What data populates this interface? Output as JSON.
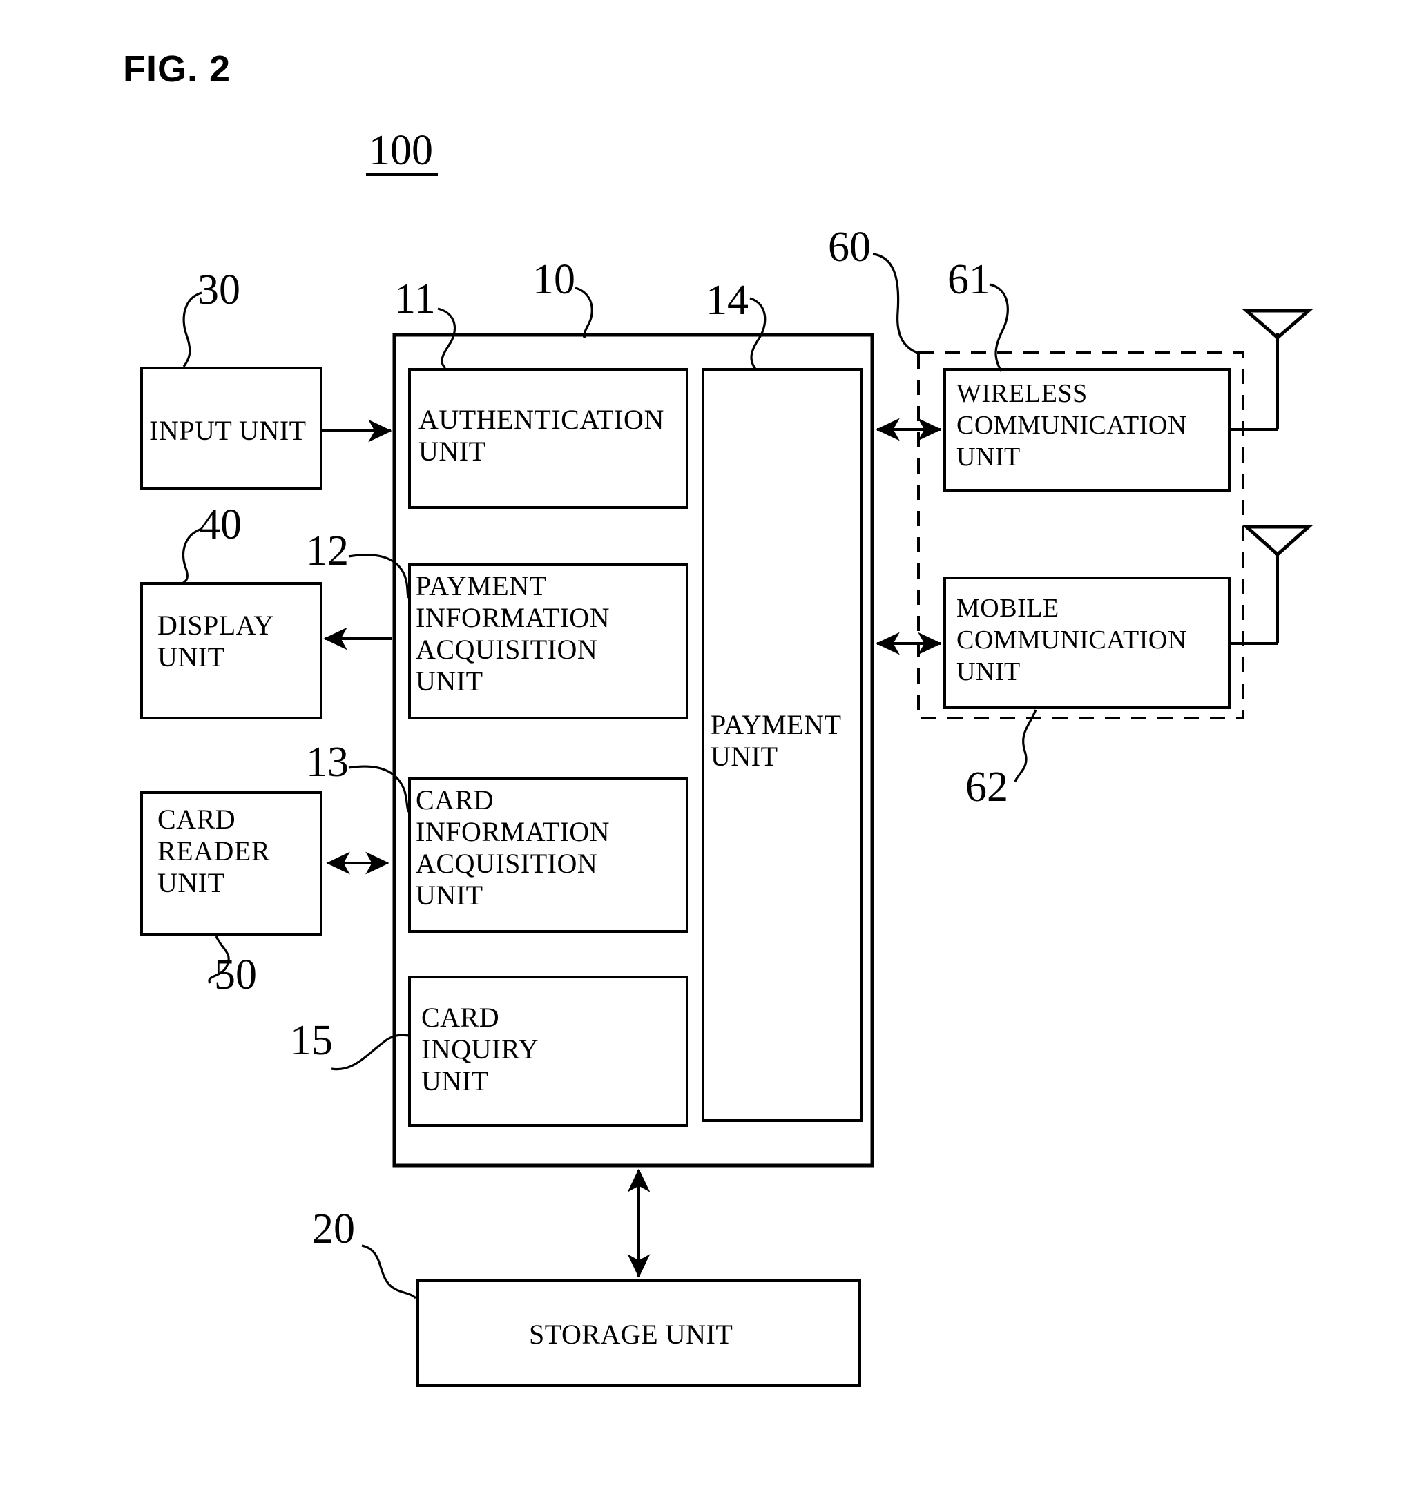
{
  "figure": {
    "title": "FIG. 2",
    "system_ref": "100"
  },
  "blocks": {
    "control_unit": {
      "ref": "10",
      "label": ""
    },
    "authentication_unit": {
      "ref": "11",
      "label_lines": [
        "AUTHENTICATION",
        "UNIT"
      ]
    },
    "payment_information_acquisition_unit": {
      "ref": "12",
      "label_lines": [
        "PAYMENT",
        "INFORMATION",
        "ACQUISITION",
        "UNIT"
      ]
    },
    "card_information_acquisition_unit": {
      "ref": "13",
      "label_lines": [
        "CARD",
        "INFORMATION",
        "ACQUISITION",
        "UNIT"
      ]
    },
    "payment_unit": {
      "ref": "14",
      "label_lines": [
        "PAYMENT",
        "UNIT"
      ]
    },
    "card_inquiry_unit": {
      "ref": "15",
      "label_lines": [
        "CARD",
        "INQUIRY",
        "UNIT"
      ]
    },
    "storage_unit": {
      "ref": "20",
      "label_lines": [
        "STORAGE UNIT"
      ]
    },
    "input_unit": {
      "ref": "30",
      "label_lines": [
        "INPUT UNIT"
      ]
    },
    "display_unit": {
      "ref": "40",
      "label_lines": [
        "DISPLAY",
        "UNIT"
      ]
    },
    "card_reader_unit": {
      "ref": "50",
      "label_lines": [
        "CARD",
        "READER",
        "UNIT"
      ]
    },
    "communication_unit": {
      "ref": "60",
      "label": ""
    },
    "wireless_communication_unit": {
      "ref": "61",
      "label_lines": [
        "WIRELESS",
        "COMMUNICATION",
        "UNIT"
      ]
    },
    "mobile_communication_unit": {
      "ref": "62",
      "label_lines": [
        "MOBILE",
        "COMMUNICATION",
        "UNIT"
      ]
    }
  },
  "icons": {
    "antenna_wireless": "antenna-icon",
    "antenna_mobile": "antenna-icon"
  },
  "colors": {
    "ink": "#000000",
    "paper": "#ffffff"
  }
}
